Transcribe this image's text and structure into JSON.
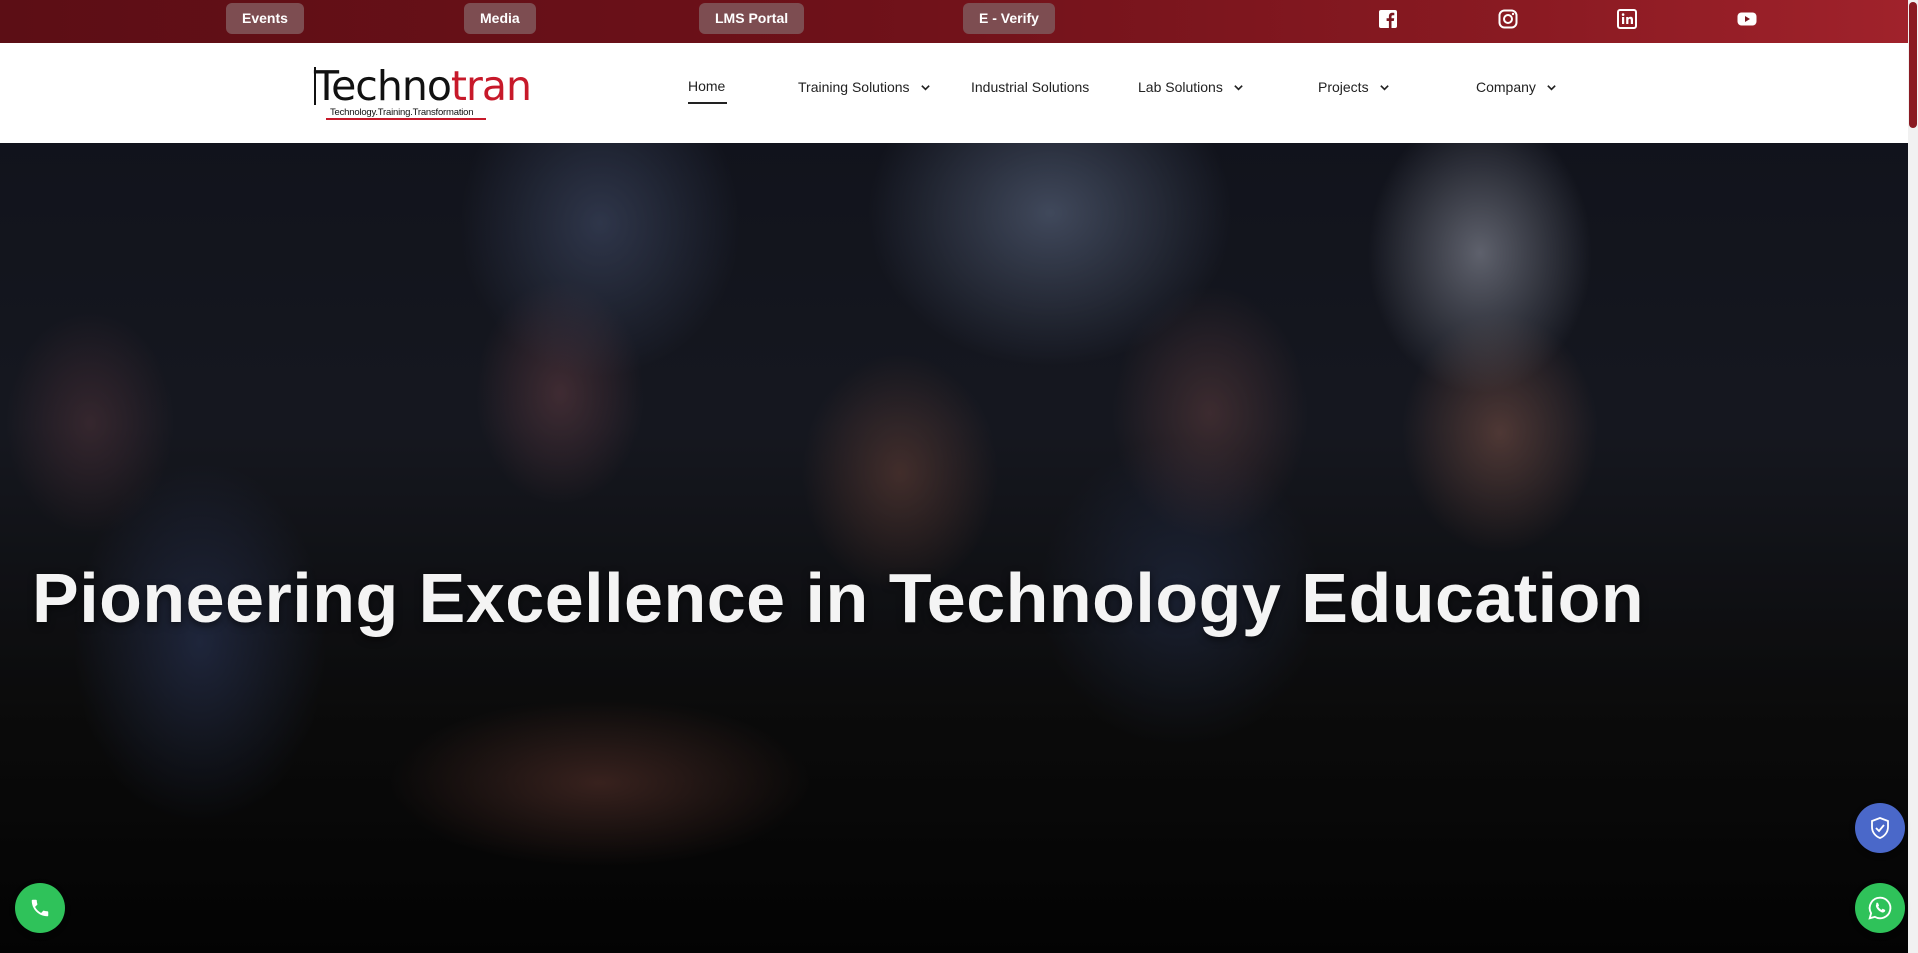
{
  "topbar": {
    "links": [
      {
        "label": "Events"
      },
      {
        "label": "Media"
      },
      {
        "label": "LMS Portal"
      },
      {
        "label": "E - Verify"
      }
    ],
    "social": [
      "facebook-icon",
      "instagram-icon",
      "linkedin-icon",
      "youtube-icon"
    ]
  },
  "header": {
    "logo": {
      "brand": "Technotran",
      "tagline": "Technology.Training.Transformation"
    },
    "nav": [
      {
        "label": "Home",
        "active": true,
        "dropdown": false
      },
      {
        "label": "Training Solutions",
        "dropdown": true
      },
      {
        "label": "Industrial Solutions",
        "dropdown": false
      },
      {
        "label": "Lab Solutions",
        "dropdown": true
      },
      {
        "label": "Projects",
        "dropdown": true
      },
      {
        "label": "Company",
        "dropdown": true
      }
    ]
  },
  "hero": {
    "title": "Pioneering Excellence in Technology Education"
  },
  "floating": {
    "phone": "phone-icon",
    "whatsapp": "whatsapp-icon",
    "security": "shield-check-icon"
  },
  "colors": {
    "topbar": "#6e1119",
    "brand_red": "#c7192a",
    "fab_green": "#2fc25a",
    "fab_blue": "#4a68c9"
  }
}
